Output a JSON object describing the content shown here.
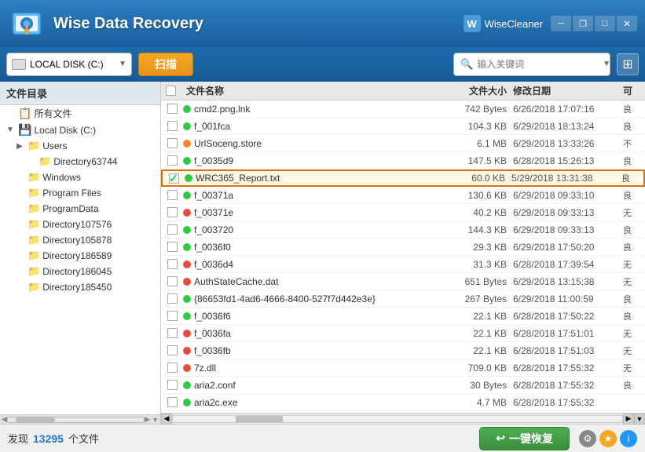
{
  "app": {
    "title": "Wise Data Recovery",
    "brand": "WiseCleaner"
  },
  "window_controls": {
    "minimize": "─",
    "maximize": "□",
    "close": "✕",
    "restore": "❐"
  },
  "toolbar": {
    "disk_label": "LOCAL DISK (C:)",
    "scan_btn": "扫描",
    "search_placeholder": "输入关键词",
    "view_icon": "⊞"
  },
  "sidebar": {
    "header": "文件目录",
    "items": [
      {
        "label": "所有文件",
        "indent": 0,
        "expand": "",
        "type": "special"
      },
      {
        "label": "Local Disk (C:)",
        "indent": 0,
        "expand": "▼",
        "type": "disk"
      },
      {
        "label": "Users",
        "indent": 1,
        "expand": "▶",
        "type": "folder"
      },
      {
        "label": "Directory63744",
        "indent": 2,
        "expand": "",
        "type": "folder"
      },
      {
        "label": "Windows",
        "indent": 1,
        "expand": "",
        "type": "folder"
      },
      {
        "label": "Program Files",
        "indent": 1,
        "expand": "",
        "type": "folder"
      },
      {
        "label": "ProgramData",
        "indent": 1,
        "expand": "",
        "type": "folder"
      },
      {
        "label": "Directory107576",
        "indent": 1,
        "expand": "",
        "type": "folder"
      },
      {
        "label": "Directory105878",
        "indent": 1,
        "expand": "",
        "type": "folder"
      },
      {
        "label": "Directory186589",
        "indent": 1,
        "expand": "",
        "type": "folder"
      },
      {
        "label": "Directory186045",
        "indent": 1,
        "expand": "",
        "type": "folder"
      },
      {
        "label": "Directory185450",
        "indent": 1,
        "expand": "",
        "type": "folder"
      }
    ]
  },
  "file_list": {
    "headers": [
      "文件名称",
      "文件大小",
      "修改日期",
      "可"
    ],
    "files": [
      {
        "name": "cmd2.png.lnk",
        "size": "742 Bytes",
        "date": "6/26/2018 17:07:16",
        "quality": "良",
        "dot": "green",
        "checked": false
      },
      {
        "name": "f_001fca",
        "size": "104.3 KB",
        "date": "6/29/2018 18:13:24",
        "quality": "良",
        "dot": "green",
        "checked": false
      },
      {
        "name": "UrlSoceng.store",
        "size": "6.1 MB",
        "date": "6/29/2018 13:33:26",
        "quality": "不",
        "dot": "orange",
        "checked": false
      },
      {
        "name": "f_0035d9",
        "size": "147.5 KB",
        "date": "6/28/2018 15:26:13",
        "quality": "良",
        "dot": "green",
        "checked": false
      },
      {
        "name": "WRC365_Report.txt",
        "size": "60.0 KB",
        "date": "5/29/2018 13:31:38",
        "quality": "良",
        "dot": "green",
        "checked": true,
        "selected": true
      },
      {
        "name": "f_00371a",
        "size": "130.6 KB",
        "date": "6/29/2018 09:33:10",
        "quality": "良",
        "dot": "green",
        "checked": false
      },
      {
        "name": "f_00371e",
        "size": "40.2 KB",
        "date": "6/29/2018 09:33:13",
        "quality": "无",
        "dot": "red",
        "checked": false
      },
      {
        "name": "f_003720",
        "size": "144.3 KB",
        "date": "6/29/2018 09:33:13",
        "quality": "良",
        "dot": "green",
        "checked": false
      },
      {
        "name": "f_0036f0",
        "size": "29.3 KB",
        "date": "6/29/2018 17:50:20",
        "quality": "良",
        "dot": "green",
        "checked": false
      },
      {
        "name": "f_0036d4",
        "size": "31.3 KB",
        "date": "6/28/2018 17:39:54",
        "quality": "无",
        "dot": "red",
        "checked": false
      },
      {
        "name": "AuthStateCache.dat",
        "size": "651 Bytes",
        "date": "6/29/2018 13:15:38",
        "quality": "无",
        "dot": "red",
        "checked": false
      },
      {
        "name": "{86653fd1-4ad6-4666-8400-527f7d442e3e}",
        "size": "267 Bytes",
        "date": "6/29/2018 11:00:59",
        "quality": "良",
        "dot": "green",
        "checked": false
      },
      {
        "name": "f_0036f6",
        "size": "22.1 KB",
        "date": "6/28/2018 17:50:22",
        "quality": "良",
        "dot": "green",
        "checked": false
      },
      {
        "name": "f_0036fa",
        "size": "22.1 KB",
        "date": "6/28/2018 17:51:01",
        "quality": "无",
        "dot": "red",
        "checked": false
      },
      {
        "name": "f_0036fb",
        "size": "22.1 KB",
        "date": "6/28/2018 17:51:03",
        "quality": "无",
        "dot": "red",
        "checked": false
      },
      {
        "name": "7z.dll",
        "size": "709.0 KB",
        "date": "6/28/2018 17:55:32",
        "quality": "无",
        "dot": "red",
        "checked": false
      },
      {
        "name": "aria2.conf",
        "size": "30 Bytes",
        "date": "6/28/2018 17:55:32",
        "quality": "良",
        "dot": "green",
        "checked": false
      },
      {
        "name": "aria2c.exe",
        "size": "4.7 MB",
        "date": "6/28/2018 17:55:32",
        "quality": "",
        "dot": "green",
        "checked": false
      }
    ]
  },
  "status_bar": {
    "found_label": "发现",
    "found_count": "13295",
    "found_suffix": "个文件",
    "recover_btn": "一键恢复",
    "recover_icon": "↩"
  }
}
